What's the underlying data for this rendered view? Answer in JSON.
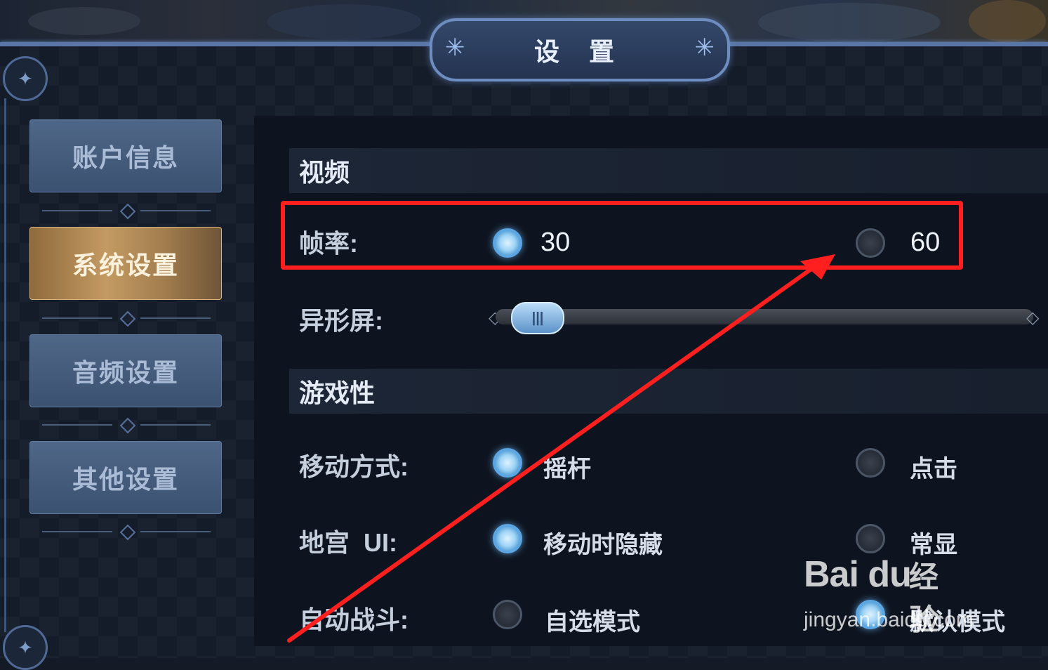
{
  "title": "设 置",
  "tabs": [
    {
      "label": "账户信息",
      "active": false
    },
    {
      "label": "系统设置",
      "active": true
    },
    {
      "label": "音频设置",
      "active": false
    },
    {
      "label": "其他设置",
      "active": false
    }
  ],
  "sections": {
    "video": "视频",
    "gameplay": "游戏性"
  },
  "settings": {
    "frame_rate": {
      "label": "帧率:",
      "options": [
        "30",
        "60"
      ],
      "selected": "30"
    },
    "notch_screen": {
      "label": "异形屏:",
      "value": 0.05
    },
    "movement": {
      "label": "移动方式:",
      "options": [
        "摇杆",
        "点击"
      ],
      "selected": "摇杆"
    },
    "dungeon_ui": {
      "label": "地宫  UI:",
      "options": [
        "移动时隐藏",
        "常显"
      ],
      "selected": "移动时隐藏"
    },
    "auto_battle": {
      "label": "自动战斗:",
      "options": [
        "自选模式",
        "默认模式"
      ],
      "selected": "默认模式"
    }
  },
  "watermark": {
    "logo": "Bai du",
    "brand": "经验",
    "url": "jingyan.baidu.com"
  },
  "colors": {
    "annotation": "#ff1f1f",
    "active_tab": "#c39a62",
    "radio_on": "#5ca7e3"
  }
}
